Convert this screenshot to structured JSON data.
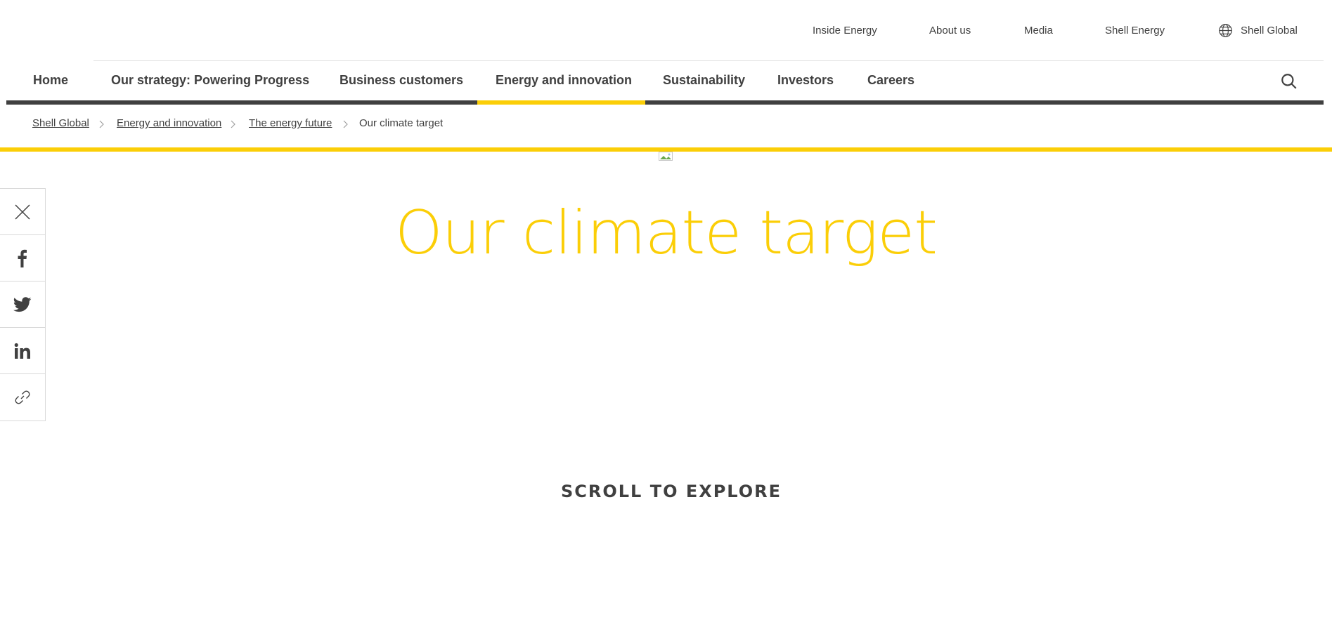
{
  "utility_nav": {
    "links": [
      "Inside Energy",
      "About us",
      "Media",
      "Shell Energy"
    ],
    "locale_label": "Shell Global"
  },
  "main_nav": {
    "items": [
      "Home",
      "Our strategy: Powering Progress",
      "Business customers",
      "Energy and innovation",
      "Sustainability",
      "Investors",
      "Careers"
    ],
    "active": "Energy and innovation"
  },
  "breadcrumb": {
    "items": [
      "Shell Global",
      "Energy and innovation",
      "The energy future",
      "Our climate target"
    ]
  },
  "hero": {
    "title": "Our climate target",
    "scroll_cta": "SCROLL TO EXPLORE"
  },
  "share_rail": {
    "icons": [
      "close-icon",
      "facebook-icon",
      "twitter-icon",
      "linkedin-icon",
      "link-icon"
    ]
  },
  "colors": {
    "brand_yellow": "#fbce07",
    "text_dark": "#404040",
    "border": "#d9d9d9"
  }
}
